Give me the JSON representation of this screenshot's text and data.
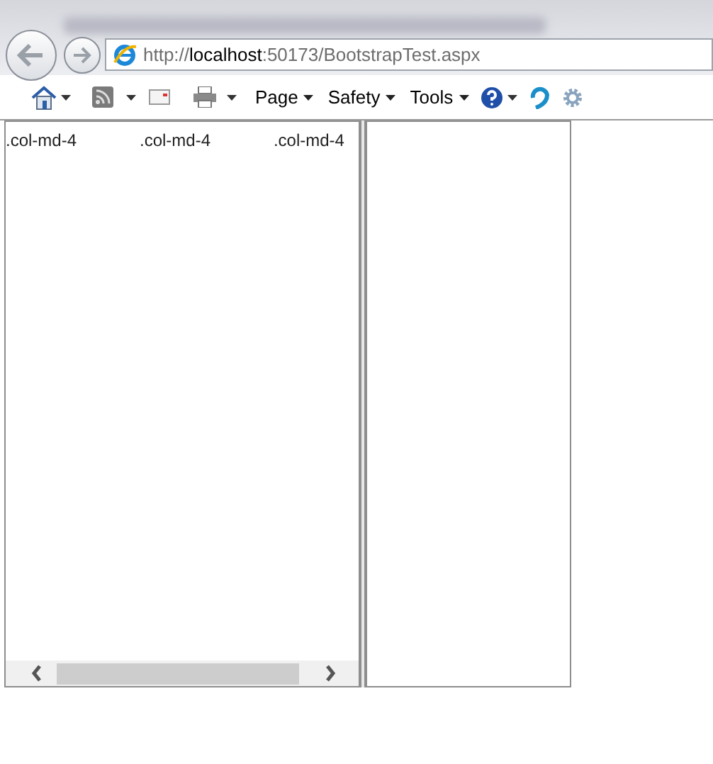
{
  "address_bar": {
    "scheme": "http://",
    "host": "localhost",
    "rest": ":50173/BootstrapTest.aspx"
  },
  "toolbar": [
    {
      "kind": "home"
    },
    {
      "kind": "feeds"
    },
    {
      "kind": "mail"
    },
    {
      "kind": "print"
    },
    {
      "kind": "menu",
      "label": "Page"
    },
    {
      "kind": "menu",
      "label": "Safety"
    },
    {
      "kind": "menu",
      "label": "Tools"
    },
    {
      "kind": "help"
    },
    {
      "kind": "addon"
    },
    {
      "kind": "gear"
    }
  ],
  "columns": [
    {
      "label": ".col-md-4"
    },
    {
      "label": ".col-md-4"
    },
    {
      "label": ".col-md-4"
    }
  ]
}
